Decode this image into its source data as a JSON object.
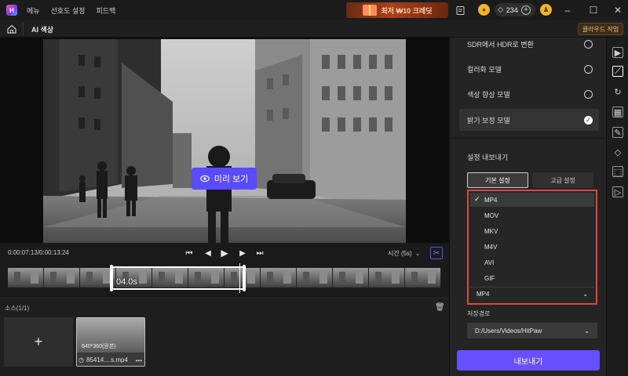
{
  "titlebar": {
    "menu": [
      "메뉴",
      "선호도 설정",
      "피드백"
    ],
    "promo_text": "최저 ₩10 크레딧",
    "credits": "234",
    "icons": [
      "app-logo",
      "notes-icon",
      "coin-icon",
      "gem-icon",
      "plus-icon",
      "user-icon",
      "minimize-icon",
      "maximize-icon",
      "close-icon"
    ]
  },
  "subbar": {
    "title": "AI 색상",
    "cloud_button": "클라우드 작업"
  },
  "preview": {
    "button_label": "미리 보기"
  },
  "controls": {
    "time": "0:00:07:13/0:00:13:24",
    "time_select": "시간 (5s)"
  },
  "timeline": {
    "selection_label": "04.0s"
  },
  "source": {
    "title": "소스(1/1)",
    "add_label": "+",
    "clip_resolution": "640*360(원본)",
    "clip_name": "85414....s.mp4",
    "more_label": "•••"
  },
  "right": {
    "options": [
      {
        "label": "SDR에서 HDR로 변환",
        "selected": false
      },
      {
        "label": "컬러화 모델",
        "selected": false
      },
      {
        "label": "색상 향상 모델",
        "selected": false
      },
      {
        "label": "밝기 보정 모델",
        "selected": true
      }
    ],
    "export_title": "설정 내보내기",
    "tabs": {
      "basic": "기본 설정",
      "advanced": "고급 설정"
    },
    "formats": [
      "MP4",
      "MOV",
      "MKV",
      "M4V",
      "AVI",
      "GIF"
    ],
    "selected_format": "MP4",
    "path_label": "저장경로",
    "path_value": "D:/Users/Videos/HitPaw",
    "export_button": "내보내기"
  },
  "colors": {
    "accent": "#6650ff",
    "highlight_border": "#e0473a"
  }
}
